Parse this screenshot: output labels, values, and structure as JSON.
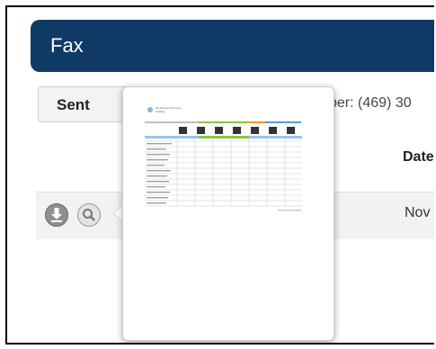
{
  "header": {
    "title": "Fax"
  },
  "tabs": {
    "sent_label": "Sent"
  },
  "info": {
    "fax_number_text": "ber: (469) 30"
  },
  "table": {
    "date_header": "Date",
    "rows": [
      {
        "date": "Nov"
      }
    ]
  },
  "preview": {
    "document_title": "GE Business Phones",
    "document_subtitle": "Catalog"
  },
  "colors": {
    "header_bg": "#0f3a66",
    "band_green": "#8cc63f",
    "band_orange": "#f7941d",
    "band_blue": "#5b9bd5"
  },
  "icons": {
    "download": "download-icon",
    "preview": "magnifier-icon"
  }
}
